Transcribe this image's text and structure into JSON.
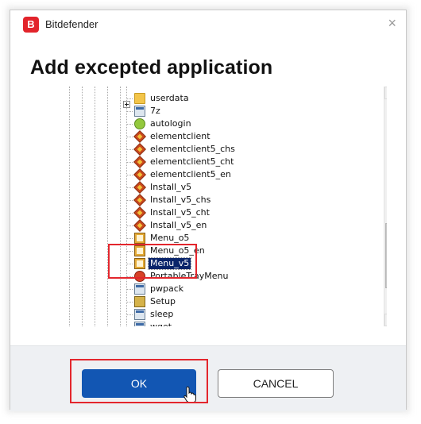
{
  "window": {
    "app_name": "Bitdefender",
    "logo_letter": "B",
    "close_glyph": "×"
  },
  "dialog": {
    "heading": "Add excepted application"
  },
  "tree": {
    "items": [
      {
        "label": "userdata",
        "icon": "folder-icon",
        "expandable": true
      },
      {
        "label": "7z",
        "icon": "exe-icon"
      },
      {
        "label": "autologin",
        "icon": "shield-icon"
      },
      {
        "label": "elementclient",
        "icon": "game-icon"
      },
      {
        "label": "elementclient5_chs",
        "icon": "game-icon"
      },
      {
        "label": "elementclient5_cht",
        "icon": "game-icon"
      },
      {
        "label": "elementclient5_en",
        "icon": "game-icon"
      },
      {
        "label": "Install_v5",
        "icon": "game-icon"
      },
      {
        "label": "Install_v5_chs",
        "icon": "game-icon"
      },
      {
        "label": "Install_v5_cht",
        "icon": "game-icon"
      },
      {
        "label": "Install_v5_en",
        "icon": "game-icon"
      },
      {
        "label": "Menu_o5",
        "icon": "menu-icon"
      },
      {
        "label": "Menu_o5_en",
        "icon": "menu-icon"
      },
      {
        "label": "Menu_v5",
        "icon": "menu-icon",
        "selected": true
      },
      {
        "label": "PortableTrayMenu",
        "icon": "tray-icon"
      },
      {
        "label": "pwpack",
        "icon": "exe-icon"
      },
      {
        "label": "Setup",
        "icon": "setup-icon"
      },
      {
        "label": "sleep",
        "icon": "exe-icon"
      },
      {
        "label": "wget",
        "icon": "exe-icon"
      }
    ]
  },
  "buttons": {
    "ok": "OK",
    "cancel": "CANCEL"
  },
  "colors": {
    "brand_red": "#e2242b",
    "primary_blue": "#1256b3",
    "highlight_red": "#e3262d",
    "selection": "#0a246a"
  }
}
